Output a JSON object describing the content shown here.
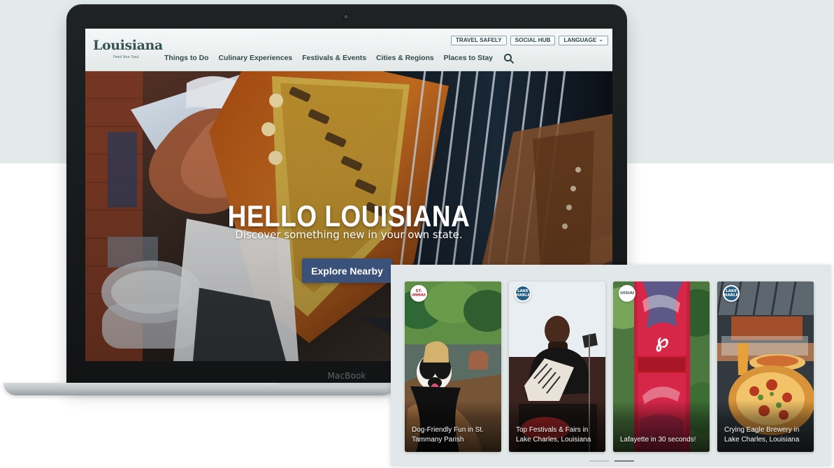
{
  "device": {
    "bezel_label": "MacBook"
  },
  "site": {
    "logo": {
      "name": "Louisiana",
      "tagline": "Feed Your Soul."
    },
    "utility_links": [
      {
        "label": "TRAVEL SAFELY"
      },
      {
        "label": "SOCIAL HUB"
      },
      {
        "label": "LANGUAGE",
        "icon": "chevron-down-icon"
      }
    ],
    "navigation": [
      "Things to Do",
      "Culinary Experiences",
      "Festivals & Events",
      "Cities & Regions",
      "Places to Stay"
    ],
    "search_icon": "search-icon",
    "hero": {
      "title": "HELLO LOUISIANA",
      "subtitle": "Discover something new in your own state.",
      "button_label": "Explore Nearby"
    }
  },
  "stories": {
    "items": [
      {
        "caption": "Dog-Friendly Fun in St. Tammany Parish",
        "badge": "ST. TAMMANY"
      },
      {
        "caption": "Top Festivals & Fairs in Lake Charles, Louisiana",
        "badge": "LAKE CHARLES"
      },
      {
        "caption": "Lafayette in 30 seconds!",
        "badge": "LOUISIANA"
      },
      {
        "caption": "Crying Eagle Brewery in Lake Charles, Louisiana",
        "badge": "LAKE CHARLES"
      }
    ],
    "page_count": 2,
    "active_page": 2
  },
  "colors": {
    "background": "#e2eaea",
    "brand_nav": "#324a4b",
    "hero_button": "#3a527a",
    "story_panel": "#e2e8e9"
  }
}
